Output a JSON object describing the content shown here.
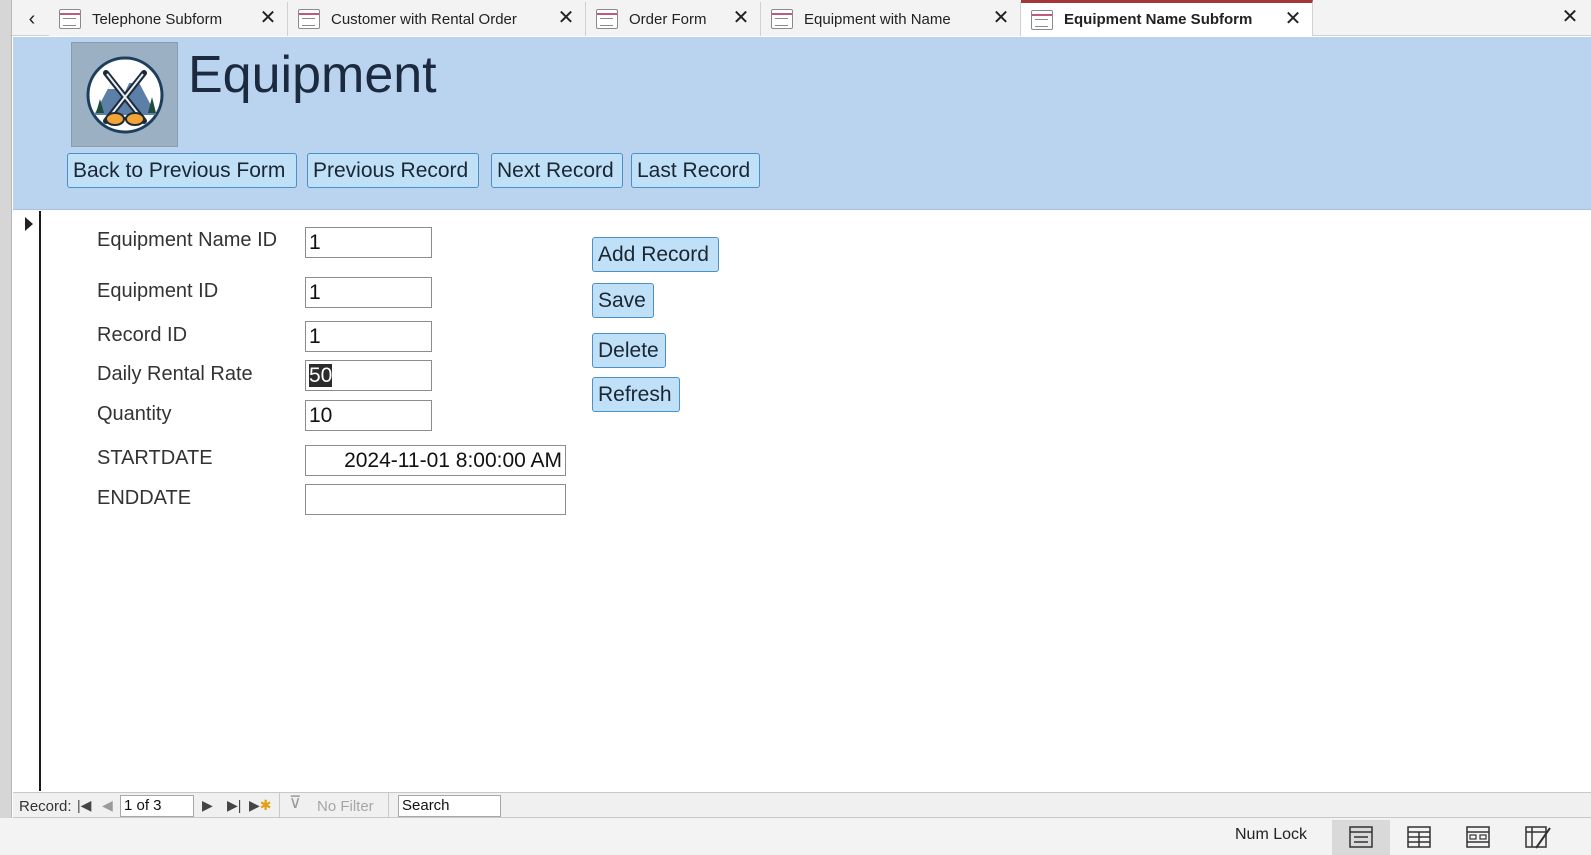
{
  "tabs": [
    {
      "label": "Telephone Subform",
      "active": false
    },
    {
      "label": "Customer with Rental Order",
      "active": false
    },
    {
      "label": "Order Form",
      "active": false
    },
    {
      "label": "Equipment with Name",
      "active": false
    },
    {
      "label": "Equipment Name Subform",
      "active": true
    }
  ],
  "header": {
    "title": "Equipment",
    "buttons": {
      "back": "Back to Previous Form",
      "previous": "Previous Record",
      "next": "Next Record",
      "last": "Last Record"
    }
  },
  "fields": {
    "equipment_name_id": {
      "label": "Equipment Name ID",
      "value": "1"
    },
    "equipment_id": {
      "label": "Equipment ID",
      "value": "1"
    },
    "record_id": {
      "label": "Record ID",
      "value": "1"
    },
    "daily_rental_rate": {
      "label": "Daily Rental Rate",
      "value": "50"
    },
    "quantity": {
      "label": "Quantity",
      "value": "10"
    },
    "startdate": {
      "label": "STARTDATE",
      "value": "2024-11-01 8:00:00 AM"
    },
    "enddate": {
      "label": "ENDDATE",
      "value": ""
    }
  },
  "actions": {
    "add": "Add Record",
    "save": "Save",
    "delete": "Delete",
    "refresh": "Refresh"
  },
  "navigation": {
    "record_label": "Record:",
    "position": "1 of 3",
    "filter_label": "No Filter",
    "search_value": "Search"
  },
  "status": {
    "num_lock": "Num Lock"
  },
  "colors": {
    "header_background": "#bad3ee",
    "button_fill": "#bfe0f7",
    "button_border": "#4a90c9",
    "active_tab_accent": "#a4373a"
  }
}
